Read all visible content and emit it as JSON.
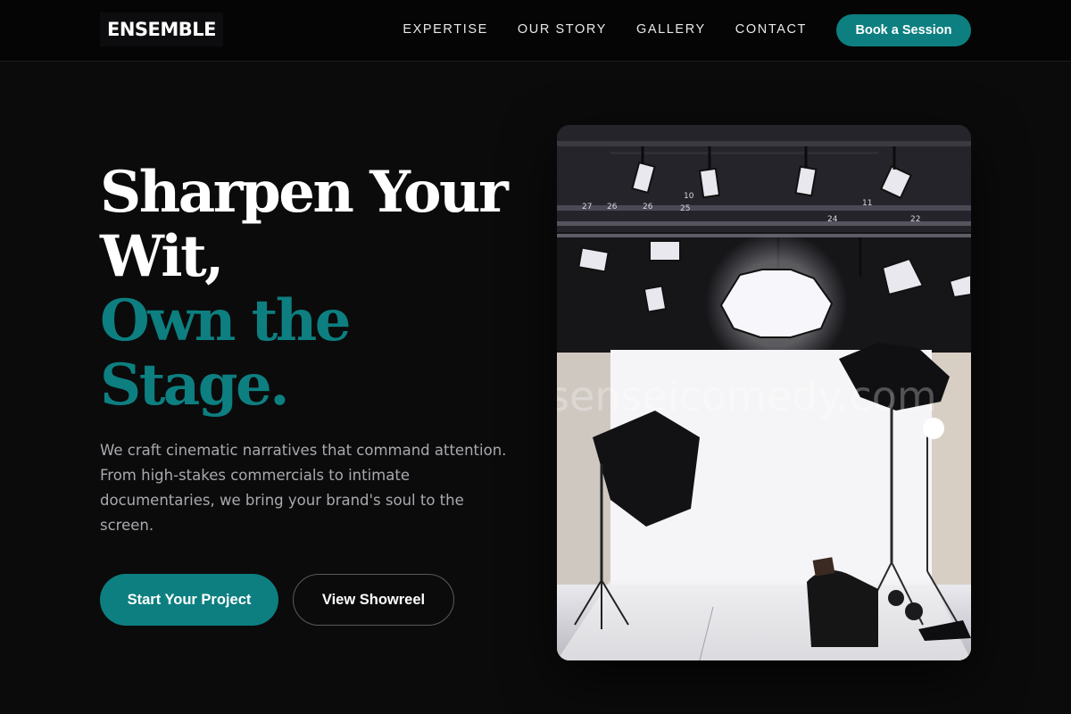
{
  "header": {
    "logo": "ENSEMBLE",
    "nav": [
      "EXPERTISE",
      "OUR STORY",
      "GALLERY",
      "CONTACT"
    ],
    "cta": "Book a Session"
  },
  "hero": {
    "title_line1": "Sharpen Your",
    "title_line2": "Wit,",
    "title_accent_line1": "Own the",
    "title_accent_line2": "Stage.",
    "description": "We craft cinematic narratives that command attention. From high-stakes commercials to intimate documentaries, we bring your brand's soul to the screen.",
    "primary_button": "Start Your Project",
    "secondary_button": "View Showreel"
  },
  "image": {
    "watermark": "senseicomedy.com",
    "rig_labels": [
      "27",
      "26",
      "26",
      "25",
      "10",
      "24",
      "11",
      "22"
    ]
  },
  "colors": {
    "accent": "#0d7f80",
    "background": "#0b0b0c",
    "header_background": "#050505",
    "muted_text": "#a9a9ae"
  }
}
